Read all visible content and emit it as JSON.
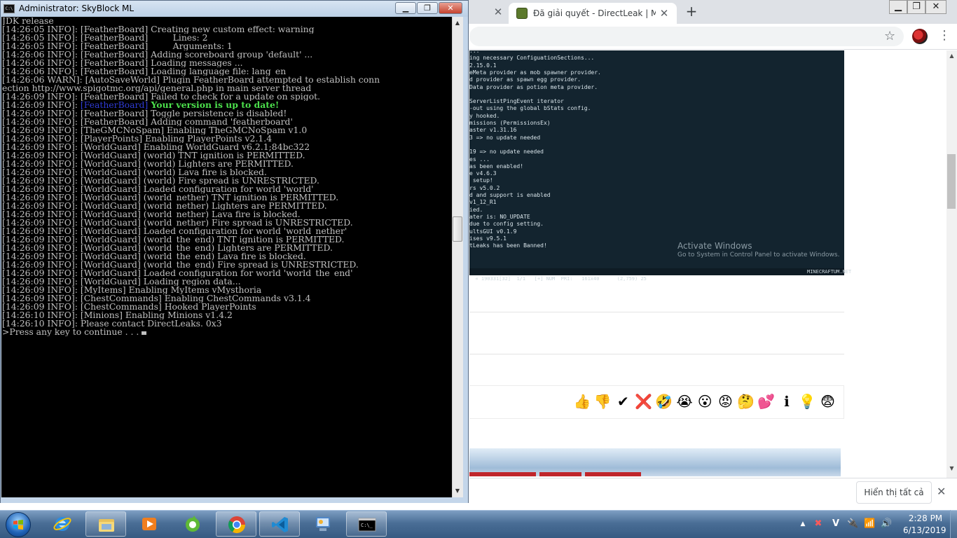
{
  "console": {
    "title": "Administrator:  SkyBlock ML",
    "lines": [
      "JDK release",
      "[14:26:05 INFO]: [FeatherBoard] Creating new custom effect: warning",
      "[14:26:05 INFO]: [FeatherBoard]         Lines: 2",
      "[14:26:05 INFO]: [FeatherBoard]         Arguments: 1",
      "[14:26:06 INFO]: [FeatherBoard] Adding scoreboard group 'default' ...",
      "[14:26:06 INFO]: [FeatherBoard] Loading messages ...",
      "[14:26:06 INFO]: [FeatherBoard] Loading language file: lang_en",
      "[14:26:06 WARN]: [AutoSaveWorld] Plugin FeatherBoard attempted to establish conn",
      "ection http://www.spigotmc.org/api/general.php in main server thread",
      "[14:26:09 INFO]: [FeatherBoard] Failed to check for a update on spigot."
    ],
    "highlight_line": {
      "prefix": "[14:26:09 INFO]: ",
      "tag": "[FeatherBoard]",
      "message": " Your version is up to date!"
    },
    "lines_after": [
      "[14:26:09 INFO]: [FeatherBoard] Toggle persistence is disabled!",
      "[14:26:09 INFO]: [FeatherBoard] Adding command 'featherboard'",
      "[14:26:09 INFO]: [TheGMCNoSpam] Enabling TheGMCNoSpam v1.0",
      "[14:26:09 INFO]: [PlayerPoints] Enabling PlayerPoints v2.1.4",
      "[14:26:09 INFO]: [WorldGuard] Enabling WorldGuard v6.2.1;84bc322",
      "[14:26:09 INFO]: [WorldGuard] (world) TNT ignition is PERMITTED.",
      "[14:26:09 INFO]: [WorldGuard] (world) Lighters are PERMITTED.",
      "[14:26:09 INFO]: [WorldGuard] (world) Lava fire is blocked.",
      "[14:26:09 INFO]: [WorldGuard] (world) Fire spread is UNRESTRICTED.",
      "[14:26:09 INFO]: [WorldGuard] Loaded configuration for world 'world'",
      "[14:26:09 INFO]: [WorldGuard] (world_nether) TNT ignition is PERMITTED.",
      "[14:26:09 INFO]: [WorldGuard] (world_nether) Lighters are PERMITTED.",
      "[14:26:09 INFO]: [WorldGuard] (world_nether) Lava fire is blocked.",
      "[14:26:09 INFO]: [WorldGuard] (world_nether) Fire spread is UNRESTRICTED.",
      "[14:26:09 INFO]: [WorldGuard] Loaded configuration for world 'world_nether'",
      "[14:26:09 INFO]: [WorldGuard] (world_the_end) TNT ignition is PERMITTED.",
      "[14:26:09 INFO]: [WorldGuard] (world_the_end) Lighters are PERMITTED.",
      "[14:26:09 INFO]: [WorldGuard] (world_the_end) Lava fire is blocked.",
      "[14:26:09 INFO]: [WorldGuard] (world_the_end) Fire spread is UNRESTRICTED.",
      "[14:26:09 INFO]: [WorldGuard] Loaded configuration for world 'world_the_end'",
      "[14:26:09 INFO]: [WorldGuard] Loading region data...",
      "[14:26:09 INFO]: [MyItems] Enabling MyItems vMysthoria",
      "[14:26:09 INFO]: [ChestCommands] Enabling ChestCommands v3.1.4",
      "[14:26:09 INFO]: [ChestCommands] Hooked PlayerPoints",
      "[14:26:10 INFO]: [Minions] Enabling Minions v1.4.2",
      "[14:26:10 INFO]: Please contact DirectLeaks. 0x3"
    ],
    "prompt": ">Press any key to continue . . . ",
    "colors": {
      "tag": "#2f3bd6",
      "uptodate": "#4ce04c",
      "text": "#c0c0c0",
      "background": "#000000"
    }
  },
  "browser": {
    "tabs": [
      {
        "label": ""
      },
      {
        "label": "Đã giải quyết - DirectLeak | Mine"
      }
    ],
    "new_tab": "+",
    "tab_close": "✕",
    "embedded_lines": [
      "...",
      "ing necessary ConfiguationSections...",
      "2.15.0.1",
      "eMeta provider as mob spawner provider.",
      "d provider as spawn egg provider.",
      "Data provider as potion meta provider.",
      "",
      "ServerListPingEvent iterator",
      "-out using the global bStats config.",
      "y hooked.",
      "missions (PermissionsEx)",
      "aster v1.31.16",
      "3 => no update needed",
      "",
      "19 => no update needed",
      "es ...",
      "as been enabled!",
      "e v4.6.3",
      " setup!",
      "rs v5.0.2",
      "d and support is enabled",
      "v1_12_R1",
      "ied.",
      "ater is: NO_UPDATE",
      "due to config setting.",
      "ultsGUI v0.1.9",
      "ises v9.5.1",
      "tLeaks has been Banned!"
    ],
    "embedded_status": "« 190331[32]  1/1   [+] NUM  PRI:   161x40      (2,759) 25",
    "embedded_status_right": "MINECRAFTUM.NET",
    "activate_title": "Activate Windows",
    "activate_sub": "Go to System in Control Panel to activate Windows.",
    "reactions": [
      "👍",
      "👎",
      "✔",
      "❌",
      "🤣",
      "😭",
      "😮",
      "😡",
      "🤔",
      "💕",
      "ℹ",
      "💡",
      "😨"
    ],
    "download_bar": {
      "show_all": "Hiển thị tất cả",
      "close": "✕"
    }
  },
  "taskbar": {
    "clock_time": "2:28 PM",
    "clock_date": "6/13/2019",
    "tray_icons": [
      "▲",
      "✖",
      "V",
      "🔌",
      "📶",
      "🔊"
    ]
  }
}
